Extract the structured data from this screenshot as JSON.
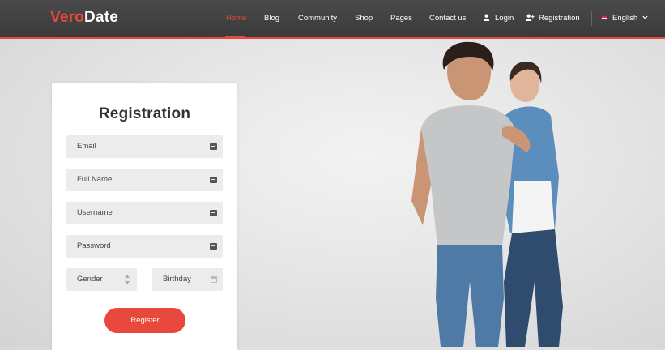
{
  "brand": {
    "part1": "Vero",
    "part2": "Date"
  },
  "nav": {
    "items": [
      "Home",
      "Blog",
      "Community",
      "Shop",
      "Pages",
      "Contact us"
    ],
    "login": "Login",
    "registration": "Registration",
    "language": "English"
  },
  "form": {
    "title": "Registration",
    "email_placeholder": "Email",
    "fullname_placeholder": "Full Name",
    "username_placeholder": "Username",
    "password_placeholder": "Password",
    "gender": "Gender",
    "birthday": "Birthday",
    "submit": "Register"
  },
  "colors": {
    "accent": "#e8493c",
    "header_bg": "#3f3f3f",
    "field_bg": "#ececec"
  },
  "icons": [
    "user-icon",
    "user-plus-icon",
    "flag-icon",
    "chevron-down-icon",
    "field-icon",
    "stepper-icon",
    "calendar-icon"
  ]
}
